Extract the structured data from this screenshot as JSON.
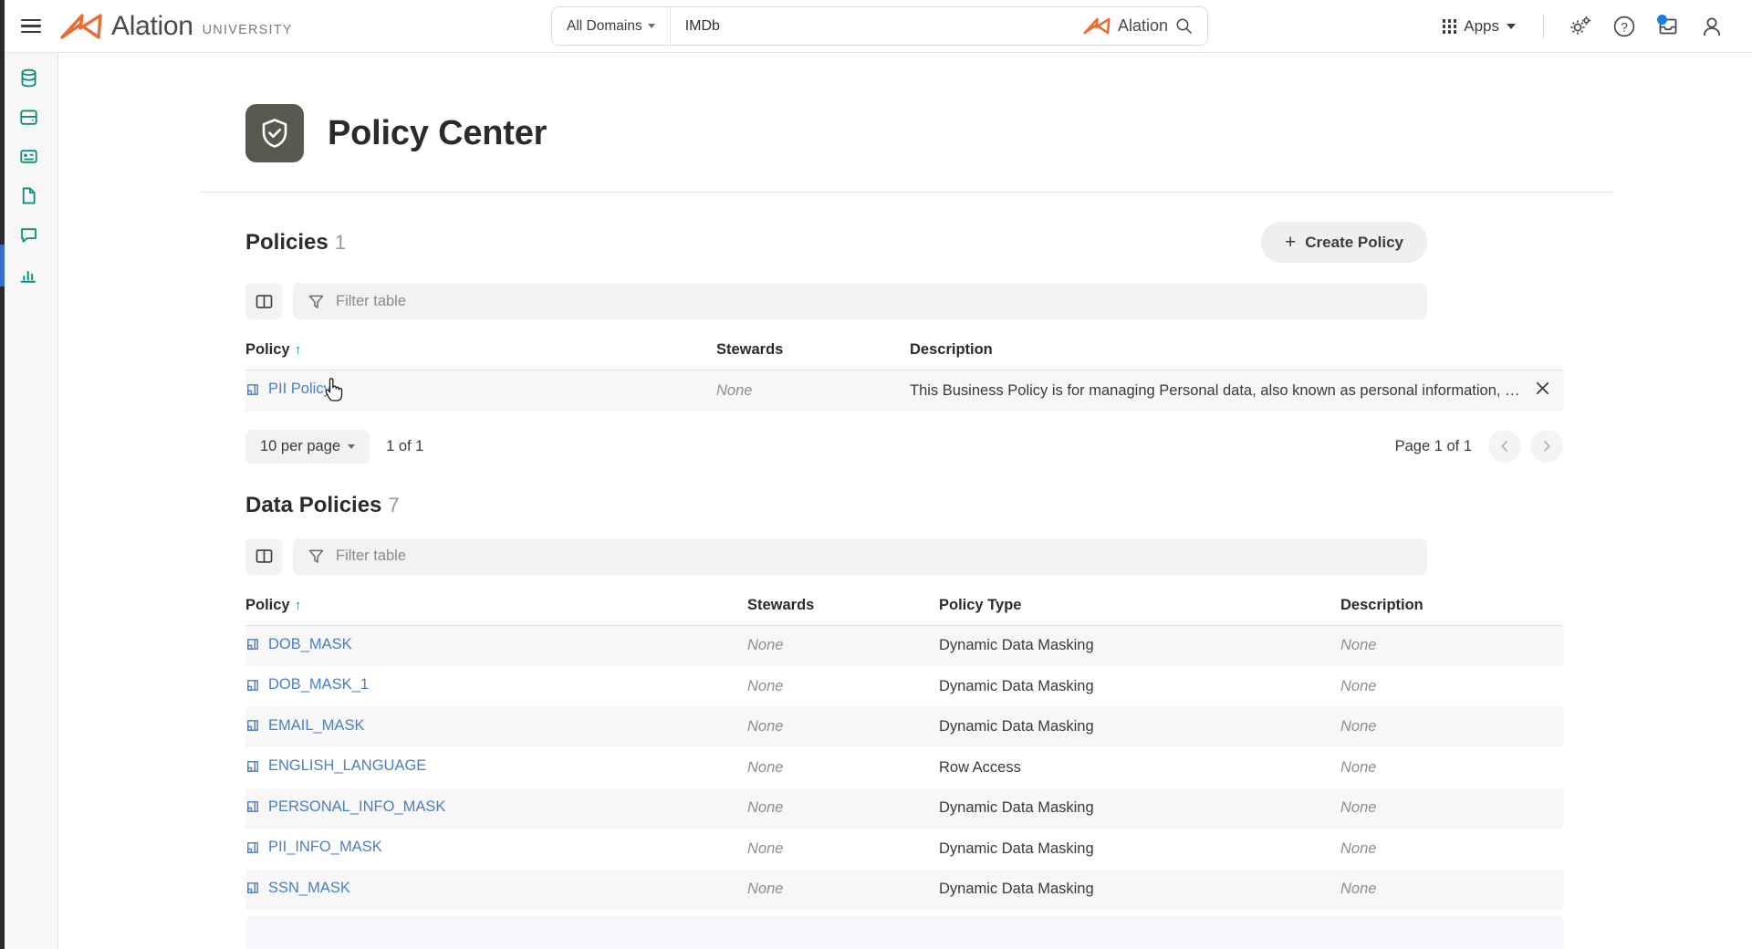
{
  "topbar": {
    "menu_icon": "hamburger-icon",
    "brand_name": "Alation",
    "brand_sub": "UNIVERSITY",
    "search": {
      "domain_label": "All Domains",
      "value": "IMDb",
      "placeholder": "Search",
      "badge_name": "Alation",
      "search_icon": "search-icon"
    },
    "apps_label": "Apps",
    "icons": {
      "settings": "gears-icon",
      "help": "question-circle-icon",
      "inbox": "inbox-icon",
      "account": "user-avatar-icon"
    }
  },
  "sidebar": {
    "items": [
      {
        "name": "sidebar-item-sources",
        "icon": "database-icon"
      },
      {
        "name": "sidebar-item-catalog",
        "icon": "archive-box-icon"
      },
      {
        "name": "sidebar-item-dashboards",
        "icon": "card-grid-icon"
      },
      {
        "name": "sidebar-item-documents",
        "icon": "document-icon"
      },
      {
        "name": "sidebar-item-conversations",
        "icon": "chat-bubble-icon"
      },
      {
        "name": "sidebar-item-analytics",
        "icon": "bar-chart-icon"
      }
    ]
  },
  "page": {
    "title": "Policy Center",
    "icon": "shield-check-icon"
  },
  "policies_section": {
    "title": "Policies",
    "count": "1",
    "create_button": "Create Policy",
    "filter_placeholder": "Filter table",
    "columns_icon": "columns-layout-icon",
    "filter_icon": "funnel-icon",
    "columns": [
      "Policy",
      "Stewards",
      "Description"
    ],
    "sort_column": "Policy",
    "sort_direction": "↑",
    "rows": [
      {
        "policy": "PII Policy",
        "stewards": "None",
        "description": "This Business Policy is for managing Personal data, also known as personal information, personally identi...",
        "close_icon": "close-icon"
      }
    ],
    "pager": {
      "per_page": "10 per page",
      "range": "1 of 1",
      "page_label": "Page 1 of 1",
      "prev_icon": "chevron-left-icon",
      "next_icon": "chevron-right-icon"
    }
  },
  "data_policies_section": {
    "title": "Data Policies",
    "count": "7",
    "filter_placeholder": "Filter table",
    "columns_icon": "columns-layout-icon",
    "filter_icon": "funnel-icon",
    "columns": [
      "Policy",
      "Stewards",
      "Policy Type",
      "Description"
    ],
    "sort_column": "Policy",
    "sort_direction": "↑",
    "rows": [
      {
        "policy": "DOB_MASK",
        "stewards": "None",
        "policy_type": "Dynamic Data Masking",
        "description": "None"
      },
      {
        "policy": "DOB_MASK_1",
        "stewards": "None",
        "policy_type": "Dynamic Data Masking",
        "description": "None"
      },
      {
        "policy": "EMAIL_MASK",
        "stewards": "None",
        "policy_type": "Dynamic Data Masking",
        "description": "None"
      },
      {
        "policy": "ENGLISH_LANGUAGE",
        "stewards": "None",
        "policy_type": "Row Access",
        "description": "None"
      },
      {
        "policy": "PERSONAL_INFO_MASK",
        "stewards": "None",
        "policy_type": "Dynamic Data Masking",
        "description": "None"
      },
      {
        "policy": "PII_INFO_MASK",
        "stewards": "None",
        "policy_type": "Dynamic Data Masking",
        "description": "None"
      },
      {
        "policy": "SSN_MASK",
        "stewards": "None",
        "policy_type": "Dynamic Data Masking",
        "description": "None"
      }
    ]
  },
  "colors": {
    "brand_orange": "#ED6A33",
    "accent_teal": "#0E8C7E",
    "link_blue": "#4A7FC1",
    "page_icon_bg": "#585A4F",
    "notification_blue": "#1A7EE8"
  }
}
